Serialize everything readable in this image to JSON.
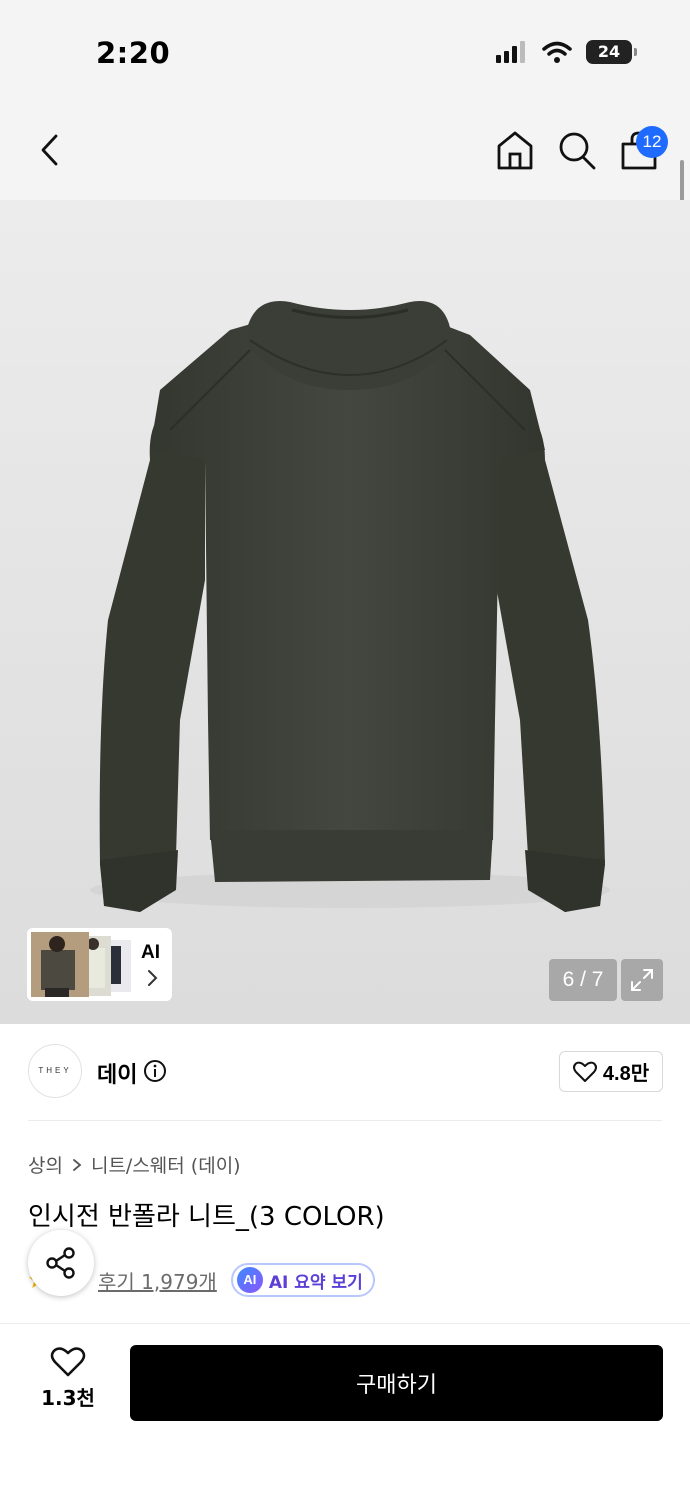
{
  "status_bar": {
    "time": "2:20",
    "battery": "24"
  },
  "nav": {
    "cart_count": "12",
    "icons": [
      "back-icon",
      "home-icon",
      "search-icon",
      "shopping-bag-icon"
    ]
  },
  "gallery": {
    "page_indicator": "6 / 7",
    "ai_label": "AI"
  },
  "brand": {
    "logo_text": "THEY",
    "name": "데이",
    "like_count": "4.8만"
  },
  "breadcrumb": [
    "상의",
    "니트/스웨터 (데이)"
  ],
  "product": {
    "title": "인시전 반폴라 니트_(3 COLOR)"
  },
  "review": {
    "link_text": "후기 1,979개",
    "ai_badge": "AI",
    "ai_summary_label": "AI 요약 보기"
  },
  "bottom_bar": {
    "wish_count": "1.3천",
    "buy_label": "구매하기"
  },
  "colors": {
    "accent_blue": "#1f6bff",
    "buy_button": "#000000",
    "sweater": "#3f423c"
  }
}
